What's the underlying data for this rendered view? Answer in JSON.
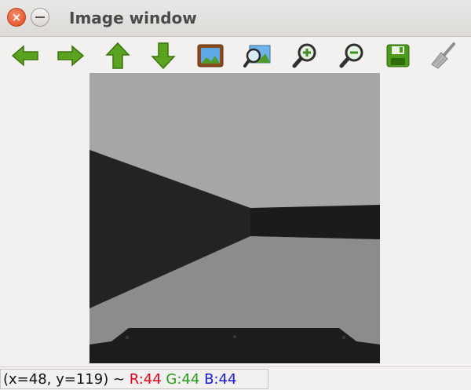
{
  "window": {
    "title": "Image window",
    "close_glyph": "×"
  },
  "toolbar": {
    "buttons": [
      {
        "icon": "arrow-left-icon"
      },
      {
        "icon": "arrow-right-icon"
      },
      {
        "icon": "arrow-up-icon"
      },
      {
        "icon": "arrow-down-icon"
      },
      {
        "icon": "image-icon"
      },
      {
        "icon": "zoom-image-icon"
      },
      {
        "icon": "zoom-in-icon"
      },
      {
        "icon": "zoom-out-icon"
      },
      {
        "icon": "save-icon"
      },
      {
        "icon": "clear-brush-icon"
      }
    ]
  },
  "status": {
    "coords": "(x=48, y=119) ~",
    "r": "R:44",
    "g": "G:44",
    "b": "B:44",
    "colors": {
      "r": "#e2001a",
      "g": "#2a9a1e",
      "b": "#1a1adb"
    }
  },
  "image": {
    "colors": {
      "ceiling": "#a6a6a7",
      "wall": "#232324",
      "wall_far": "#1b1b1c",
      "floor": "#8c8c8d",
      "object": "#1c1c1d"
    }
  }
}
